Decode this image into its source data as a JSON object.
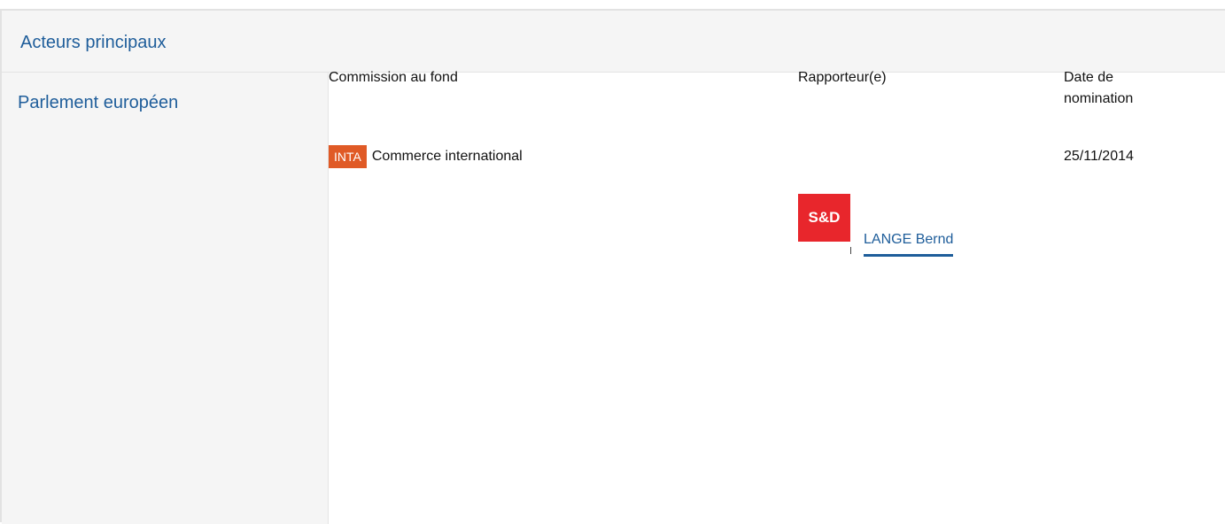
{
  "section": {
    "title": "Acteurs principaux"
  },
  "institution": {
    "label": "Parlement européen"
  },
  "table": {
    "headers": {
      "committee": "Commission au fond",
      "rapporteur": "Rapporteur(e)",
      "date": "Date de nomination"
    },
    "rows": [
      {
        "committee_code": "INTA",
        "committee_name": "Commerce international",
        "date": "25/11/2014",
        "rapporteur_group": "S&D",
        "rapporteur_name": "LANGE Bernd"
      }
    ]
  },
  "colors": {
    "accent_blue": "#1e5d9a",
    "committee_badge": "#e05a26",
    "group_logo": "#e8262c"
  }
}
